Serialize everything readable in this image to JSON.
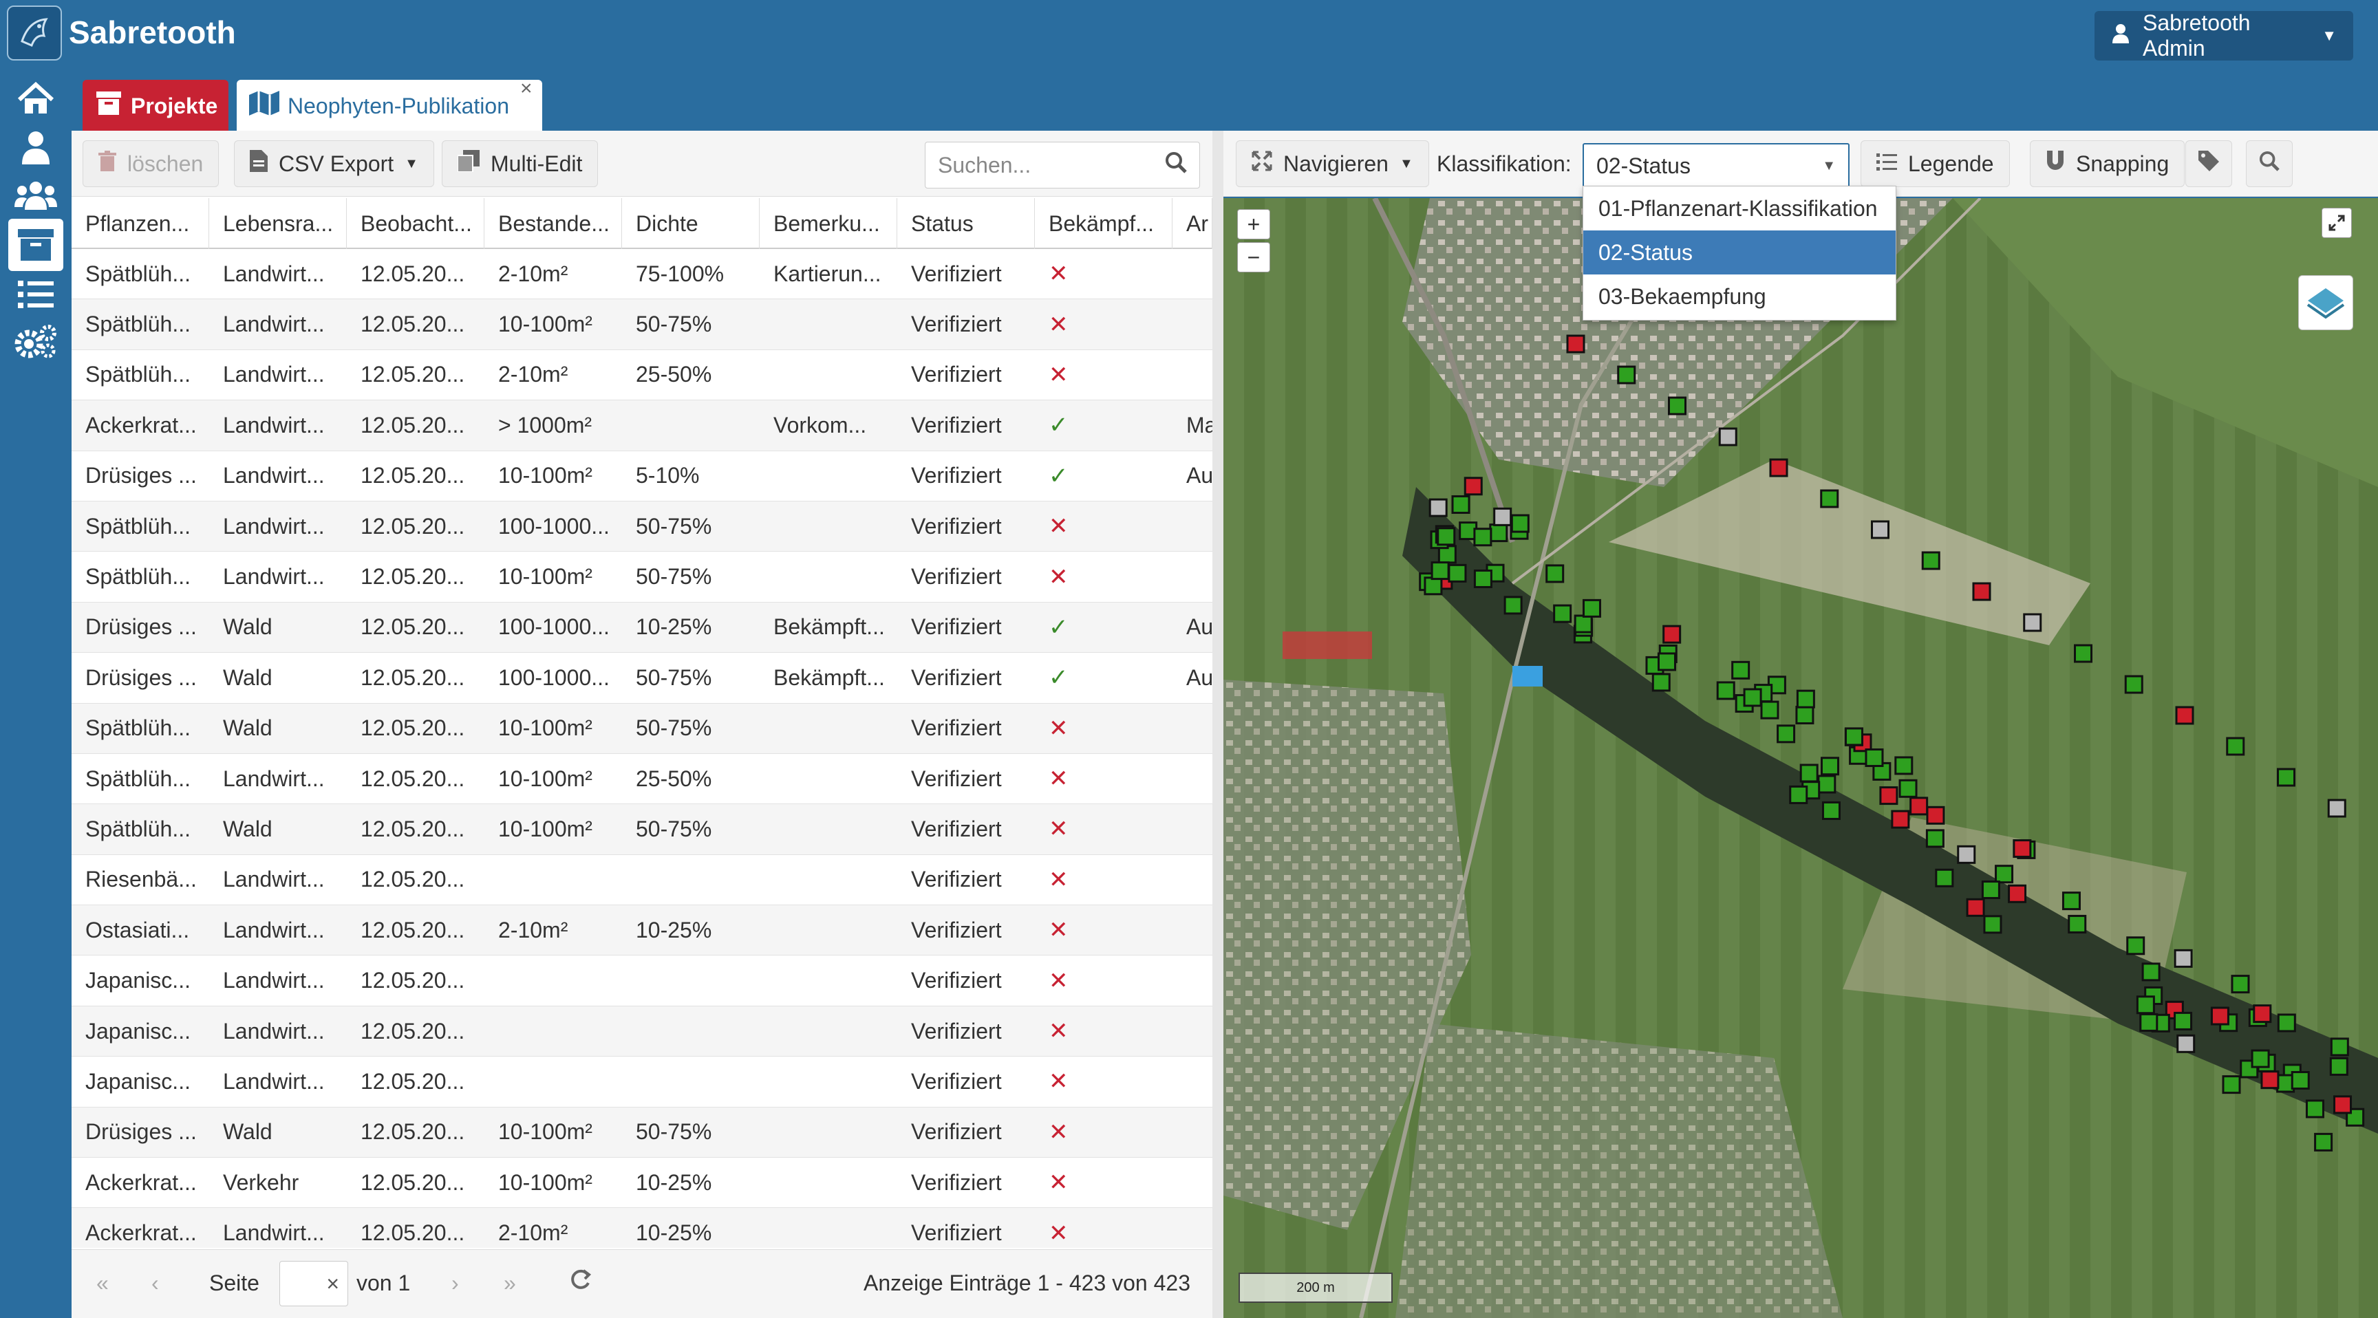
{
  "app": {
    "title": "Sabretooth",
    "user": "Sabretooth Admin"
  },
  "tabs": [
    {
      "label": "Projekte"
    },
    {
      "label": "Neophyten-Publikation"
    }
  ],
  "toolbar": {
    "delete": "löschen",
    "csv": "CSV Export",
    "multi_edit": "Multi-Edit",
    "search_placeholder": "Suchen..."
  },
  "columns": [
    "Pflanzen...",
    "Lebensra...",
    "Beobacht...",
    "Bestande...",
    "Dichte",
    "Bemerku...",
    "Status",
    "Bekämpf...",
    "Ar"
  ],
  "rows": [
    [
      "Spätblüh...",
      "Landwirt...",
      "12.05.20...",
      "2-10m²",
      "75-100%",
      "Kartierun...",
      "Verifiziert",
      "x",
      ""
    ],
    [
      "Spätblüh...",
      "Landwirt...",
      "12.05.20...",
      "10-100m²",
      "50-75%",
      "",
      "Verifiziert",
      "x",
      ""
    ],
    [
      "Spätblüh...",
      "Landwirt...",
      "12.05.20...",
      "2-10m²",
      "25-50%",
      "",
      "Verifiziert",
      "x",
      ""
    ],
    [
      "Ackerkrat...",
      "Landwirt...",
      "12.05.20...",
      "> 1000m²",
      "",
      "Vorkom...",
      "Verifiziert",
      "check",
      "Ma"
    ],
    [
      "Drüsiges ...",
      "Landwirt...",
      "12.05.20...",
      "10-100m²",
      "5-10%",
      "",
      "Verifiziert",
      "check",
      "Au"
    ],
    [
      "Spätblüh...",
      "Landwirt...",
      "12.05.20...",
      "100-1000...",
      "50-75%",
      "",
      "Verifiziert",
      "x",
      ""
    ],
    [
      "Spätblüh...",
      "Landwirt...",
      "12.05.20...",
      "10-100m²",
      "50-75%",
      "",
      "Verifiziert",
      "x",
      ""
    ],
    [
      "Drüsiges ...",
      "Wald",
      "12.05.20...",
      "100-1000...",
      "10-25%",
      "Bekämpft...",
      "Verifiziert",
      "check",
      "Au"
    ],
    [
      "Drüsiges ...",
      "Wald",
      "12.05.20...",
      "100-1000...",
      "50-75%",
      "Bekämpft...",
      "Verifiziert",
      "check",
      "Au"
    ],
    [
      "Spätblüh...",
      "Wald",
      "12.05.20...",
      "10-100m²",
      "50-75%",
      "",
      "Verifiziert",
      "x",
      ""
    ],
    [
      "Spätblüh...",
      "Landwirt...",
      "12.05.20...",
      "10-100m²",
      "25-50%",
      "",
      "Verifiziert",
      "x",
      ""
    ],
    [
      "Spätblüh...",
      "Wald",
      "12.05.20...",
      "10-100m²",
      "50-75%",
      "",
      "Verifiziert",
      "x",
      ""
    ],
    [
      "Riesenbä...",
      "Landwirt...",
      "12.05.20...",
      "",
      "",
      "",
      "Verifiziert",
      "x",
      ""
    ],
    [
      "Ostasiati...",
      "Landwirt...",
      "12.05.20...",
      "2-10m²",
      "10-25%",
      "",
      "Verifiziert",
      "x",
      ""
    ],
    [
      "Japanisc...",
      "Landwirt...",
      "12.05.20...",
      "",
      "",
      "",
      "Verifiziert",
      "x",
      ""
    ],
    [
      "Japanisc...",
      "Landwirt...",
      "12.05.20...",
      "",
      "",
      "",
      "Verifiziert",
      "x",
      ""
    ],
    [
      "Japanisc...",
      "Landwirt...",
      "12.05.20...",
      "",
      "",
      "",
      "Verifiziert",
      "x",
      ""
    ],
    [
      "Drüsiges ...",
      "Wald",
      "12.05.20...",
      "10-100m²",
      "50-75%",
      "",
      "Verifiziert",
      "x",
      ""
    ],
    [
      "Ackerkrat...",
      "Verkehr",
      "12.05.20...",
      "10-100m²",
      "10-25%",
      "",
      "Verifiziert",
      "x",
      ""
    ],
    [
      "Ackerkrat...",
      "Landwirt...",
      "12.05.20...",
      "2-10m²",
      "10-25%",
      "",
      "Verifiziert",
      "x",
      ""
    ]
  ],
  "pager": {
    "page_label": "Seite",
    "of_label": "von 1",
    "summary": "Anzeige Einträge 1 - 423 von 423"
  },
  "map_toolbar": {
    "navigate": "Navigieren",
    "klass_label": "Klassifikation:",
    "klass_value": "02-Status",
    "legend": "Legende",
    "snapping": "Snapping"
  },
  "klass_options": [
    "01-Pflanzenart-Klassifikation",
    "02-Status",
    "03-Bekaempfung"
  ],
  "map": {
    "scale": "200 m",
    "zoom_in": "+",
    "zoom_out": "−"
  },
  "colors": {
    "primary": "#2a6d9f",
    "danger": "#c72233",
    "marker_ok": "#2ea01f",
    "marker_bad": "#d01e2a",
    "marker_neutral": "#b8b8b8"
  }
}
